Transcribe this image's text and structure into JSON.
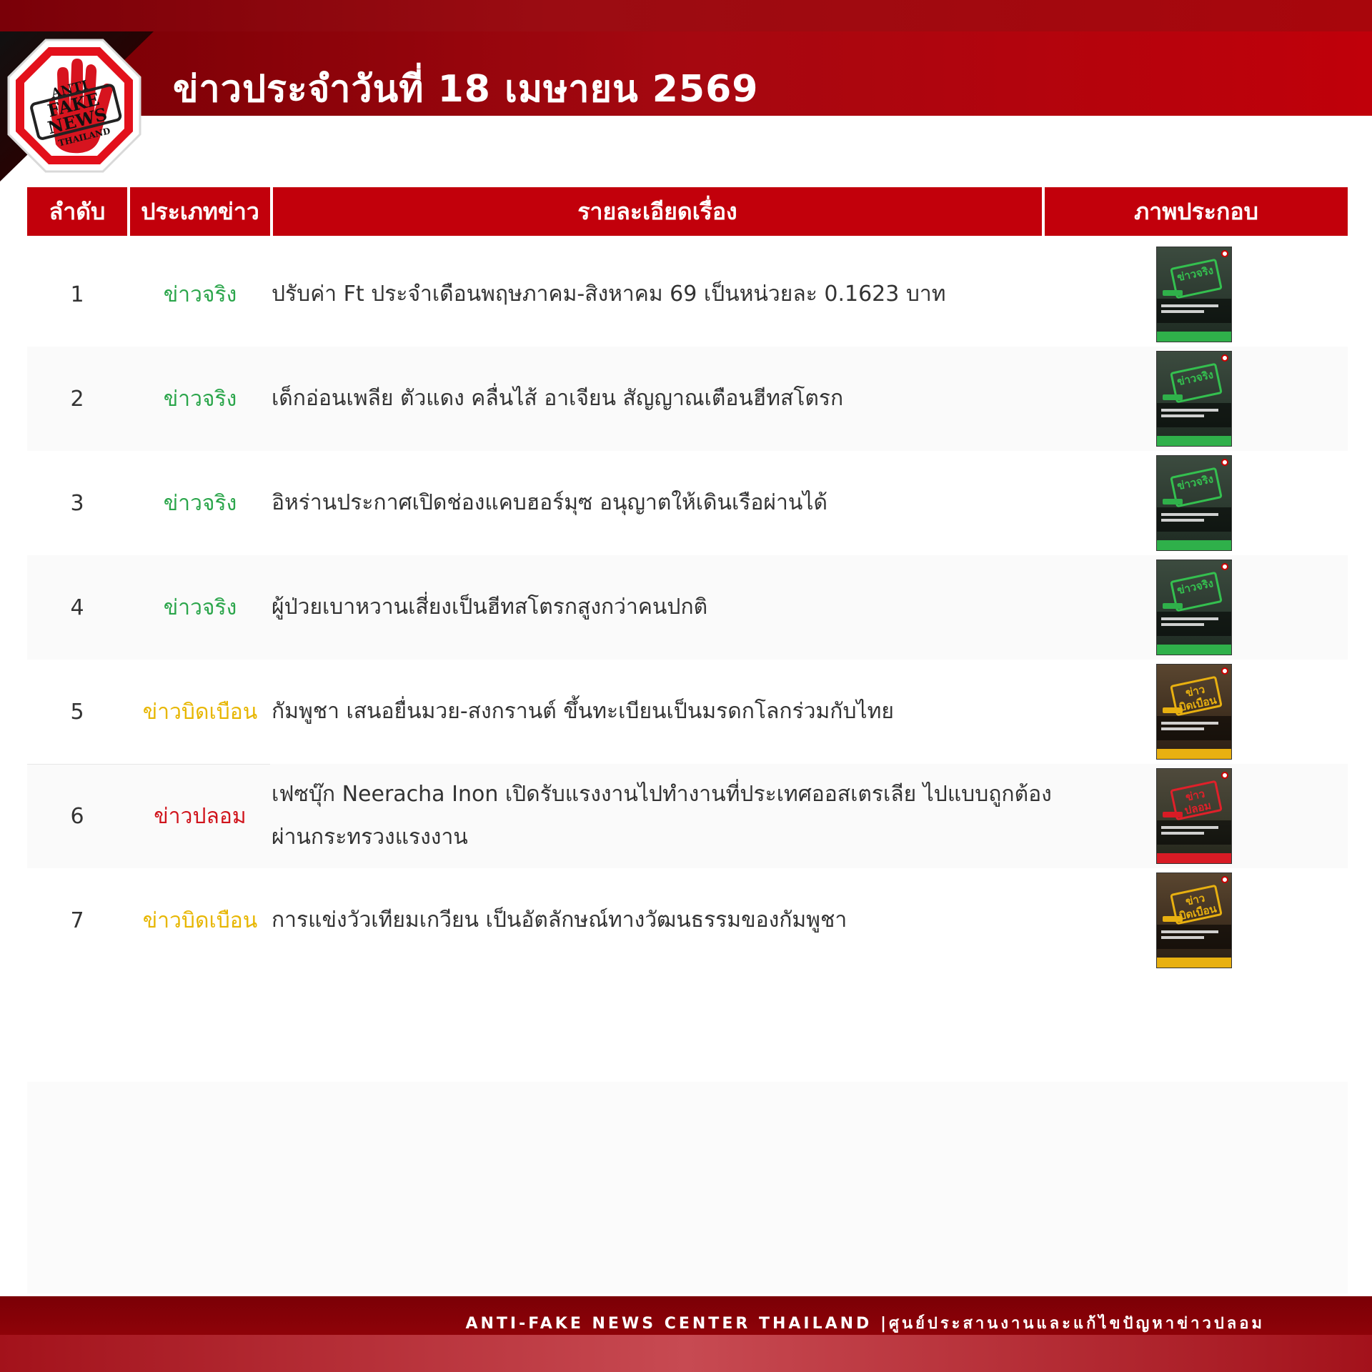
{
  "header": {
    "title": "ข่าวประจำวันที่ 18 เมษายน 2569",
    "logo_text": [
      "ANTI",
      "FAKE",
      "NEWS",
      "THAILAND"
    ]
  },
  "table": {
    "columns": {
      "number": "ลำดับ",
      "type": "ประเภทข่าว",
      "details": "รายละเอียดเรื่อง",
      "image": "ภาพประกอบ"
    },
    "rows": [
      {
        "number": "1",
        "type": "ข่าวจริง",
        "type_kind": "true",
        "details": "ปรับค่า Ft ประจำเดือนพฤษภาคม-สิงหาคม 69 เป็นหน่วยละ 0.1623 บาท",
        "thumb_stamp": "ข่าวจริง"
      },
      {
        "number": "2",
        "type": "ข่าวจริง",
        "type_kind": "true",
        "details": "เด็กอ่อนเพลีย ตัวแดง คลื่นไส้ อาเจียน สัญญาณเตือนฮีทสโตรก",
        "thumb_stamp": "ข่าวจริง"
      },
      {
        "number": "3",
        "type": "ข่าวจริง",
        "type_kind": "true",
        "details": "อิหร่านประกาศเปิดช่องแคบฮอร์มุซ อนุญาตให้เดินเรือผ่านได้",
        "thumb_stamp": "ข่าวจริง"
      },
      {
        "number": "4",
        "type": "ข่าวจริง",
        "type_kind": "true",
        "details": "ผู้ป่วยเบาหวานเสี่ยงเป็นฮีทสโตรกสูงกว่าคนปกติ",
        "thumb_stamp": "ข่าวจริง"
      },
      {
        "number": "5",
        "type": "ข่าวบิดเบือน",
        "type_kind": "distorted",
        "details": "กัมพูชา เสนอยื่นมวย-สงกรานต์ ขึ้นทะเบียนเป็นมรดกโลกร่วมกับไทย",
        "thumb_stamp": "ข่าวบิดเบือน"
      },
      {
        "number": "6",
        "type": "ข่าวปลอม",
        "type_kind": "fake",
        "details": "เฟซบุ๊ก Neeracha Inon เปิดรับแรงงานไปทำงานที่ประเทศออสเตรเลีย ไปแบบถูกต้อง ผ่านกระทรวงแรงงาน",
        "thumb_stamp": "ข่าวปลอม"
      },
      {
        "number": "7",
        "type": "ข่าวบิดเบือน",
        "type_kind": "distorted",
        "details": "การแข่งวัวเทียมเกวียน เป็นอัตลักษณ์ทางวัฒนธรรมของกัมพูชา",
        "thumb_stamp": "ข่าวบิดเบือน"
      }
    ]
  },
  "footer": {
    "text": "ANTI-FAKE NEWS CENTER THAILAND |ศูนย์ประสานงานและแก้ไขปัญหาข่าวปลอม"
  },
  "colors": {
    "brand_red": "#c2000b",
    "true_news": "#2aa54a",
    "distorted_news": "#e7b600",
    "fake_news": "#d0141c"
  },
  "icons": {
    "logo": "anti-fake-news-stop-sign-hand-icon"
  }
}
